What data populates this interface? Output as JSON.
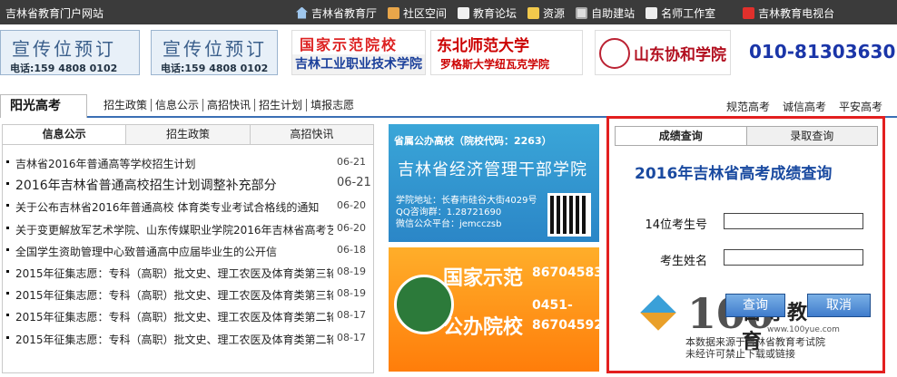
{
  "topbar": {
    "site_name": "吉林省教育门户网站",
    "nav": [
      {
        "label": "吉林省教育厅",
        "icon": "home-icon"
      },
      {
        "label": "社区空间",
        "icon": "community-icon"
      },
      {
        "label": "教育论坛",
        "icon": "forum-icon"
      },
      {
        "label": "资源",
        "icon": "resource-icon"
      },
      {
        "label": "自助建站",
        "icon": "site-builder-icon"
      },
      {
        "label": "名师工作室",
        "icon": "teacher-studio-icon"
      }
    ],
    "tv": {
      "label": "吉林教育电视台",
      "icon": "tv-icon"
    }
  },
  "ads": {
    "ad1": {
      "title": "宣传位预订",
      "phone": "电话:159 4808 0102"
    },
    "ad2": {
      "title": "宣传位预订",
      "phone": "电话:159 4808 0102"
    },
    "ad3": {
      "line1": "国家示范院校",
      "line2": "吉林工业职业技术学院"
    },
    "ad4": {
      "line1": "东北师范大学",
      "line2": "罗格斯大学纽瓦克学院"
    },
    "ad5": {
      "name": "山东协和学院"
    },
    "phone": "010-81303630"
  },
  "section": {
    "title": "阳光高考",
    "subnav": [
      "招生政策",
      "信息公示",
      "高招快讯",
      "招生计划",
      "填报志愿"
    ],
    "right_links": [
      "规范高考",
      "诚信高考",
      "平安高考"
    ]
  },
  "news": {
    "tabs": [
      "信息公示",
      "招生政策",
      "高招快讯"
    ],
    "items": [
      {
        "text": "吉林省2016年普通高等学校招生计划",
        "date": "06-21"
      },
      {
        "text": "2016年吉林省普通高校招生计划调整补充部分",
        "date": "06-21"
      },
      {
        "text": "关于公布吉林省2016年普通高校 体育类专业考试合格线的通知",
        "date": "06-20"
      },
      {
        "text": "关于变更解放军艺术学院、山东传媒职业学院2016年吉林省高考艺",
        "date": "06-20"
      },
      {
        "text": "全国学生资助管理中心致普通高中应届毕业生的公开信",
        "date": "06-18"
      },
      {
        "text": "2015年征集志愿：专科（高职）批文史、理工农医及体育类第三轮",
        "date": "08-19"
      },
      {
        "text": "2015年征集志愿：专科（高职）批文史、理工农医及体育类第三轮",
        "date": "08-19"
      },
      {
        "text": "2015年征集志愿：专科（高职）批文史、理工农医及体育类第二轮",
        "date": "08-17"
      },
      {
        "text": "2015年征集志愿：专科（高职）批文史、理工农医及体育类第二轮",
        "date": "08-17"
      }
    ]
  },
  "banner1": {
    "header": "省属公办高校（院校代码：2263）",
    "name": "吉林省经济管理干部学院",
    "address": "学院地址：长春市硅谷大街4029号",
    "qq": "QQ咨询群：1.28721690",
    "wechat": "微信公众平台：jemcczsb"
  },
  "banner2": {
    "line1": "国家示范",
    "line2": "公办院校",
    "phone1": "86704583",
    "phone2": "0451-",
    "phone3": "86704592"
  },
  "panel": {
    "tabs": [
      "成绩查询",
      "录取查询"
    ],
    "title": "2016年吉林省高考成绩查询",
    "field1_label": "14位考生号",
    "field2_label": "考生姓名",
    "query_label": "查询",
    "cancel_label": "取消",
    "watermark_big": "100",
    "watermark_cn": "百导教育",
    "watermark_url": "www.100yue.com",
    "notice1": "本数据来源于吉林省教育考试院",
    "notice2": "未经许可禁止下载或链接"
  },
  "colors": {
    "topbar_bg": "#3b3b3b",
    "accent_blue": "#3a6fb4",
    "panel_border": "#e31f1f",
    "title_blue": "#1a4aa0"
  }
}
